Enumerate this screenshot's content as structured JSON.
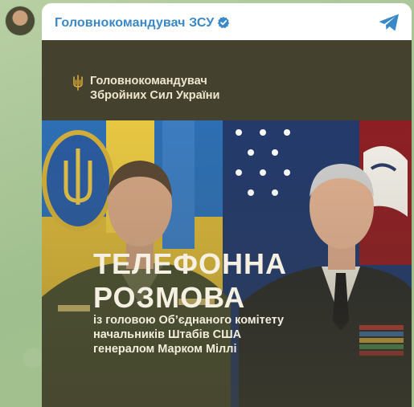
{
  "channel": {
    "name": "Головнокомандувач ЗСУ",
    "verified_icon": "verified-badge-icon",
    "share_icon": "telegram-share-icon",
    "accent_color": "#3a88c8"
  },
  "poster": {
    "org_line1": "Головнокомандувач",
    "org_line2": "Збройних Сил України",
    "headline_line1": "ТЕЛЕФОННА",
    "headline_line2": "РОЗМОВА",
    "subtitle_line1": "із головою Об’єднаного комітету",
    "subtitle_line2": "начальників Штабів США",
    "subtitle_line3": "генералом Марком Міллі",
    "emblem_icon": "trident-icon",
    "background_color": "#45412f"
  }
}
